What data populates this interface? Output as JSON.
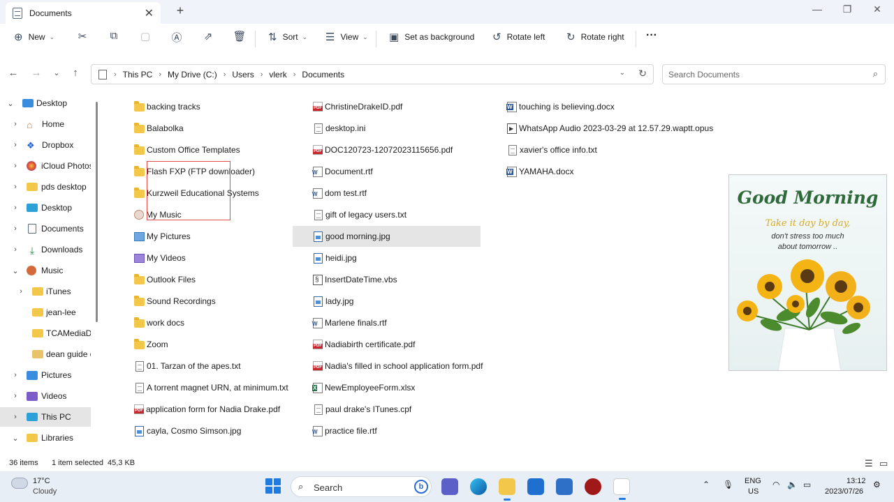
{
  "window": {
    "tab_title": "Documents"
  },
  "toolbar": {
    "new_label": "New",
    "sort_label": "Sort",
    "view_label": "View",
    "set_background_label": "Set as background",
    "rotate_left_label": "Rotate left",
    "rotate_right_label": "Rotate right",
    "more_label": "···"
  },
  "address": {
    "crumbs": [
      "This PC",
      "My Drive (C:)",
      "Users",
      "vlerk",
      "Documents"
    ],
    "search_placeholder": "Search Documents"
  },
  "sidebar": {
    "items": [
      {
        "label": "Desktop",
        "icon": "desktop-icon",
        "chevron": "down"
      },
      {
        "label": "Home",
        "icon": "home-icon",
        "chevron": "right"
      },
      {
        "label": "Dropbox",
        "icon": "dropbox-icon",
        "chevron": "right"
      },
      {
        "label": "iCloud Photos",
        "icon": "icloud-photos-icon",
        "chevron": "right"
      },
      {
        "label": "pds desktop",
        "icon": "folder-icon",
        "chevron": "right"
      },
      {
        "label": "Desktop",
        "icon": "desktop-icon",
        "chevron": "right"
      },
      {
        "label": "Documents",
        "icon": "documents-icon",
        "chevron": "right"
      },
      {
        "label": "Downloads",
        "icon": "downloads-icon",
        "chevron": "right"
      },
      {
        "label": "Music",
        "icon": "music-icon",
        "chevron": "down"
      },
      {
        "label": "iTunes",
        "icon": "folder-icon",
        "chevron": "right"
      },
      {
        "label": "jean-lee",
        "icon": "folder-icon",
        "chevron": ""
      },
      {
        "label": "TCAMediaDo",
        "icon": "folder-icon",
        "chevron": ""
      },
      {
        "label": "dean guide d",
        "icon": "folder-icon",
        "chevron": ""
      },
      {
        "label": "Pictures",
        "icon": "pictures-icon",
        "chevron": "right"
      },
      {
        "label": "Videos",
        "icon": "videos-icon",
        "chevron": "right"
      },
      {
        "label": "This PC",
        "icon": "this-pc-icon",
        "chevron": "right"
      },
      {
        "label": "Libraries",
        "icon": "libraries-icon",
        "chevron": "down"
      }
    ]
  },
  "files": {
    "column1": [
      {
        "name": "backing tracks",
        "type": "folder"
      },
      {
        "name": "Balabolka",
        "type": "folder"
      },
      {
        "name": "Custom Office Templates",
        "type": "folder"
      },
      {
        "name": "Flash FXP (FTP downloader)",
        "type": "folder"
      },
      {
        "name": "Kurzweil Educational Systems",
        "type": "folder"
      },
      {
        "name": "My Music",
        "type": "music"
      },
      {
        "name": "My Pictures",
        "type": "pics"
      },
      {
        "name": "My Videos",
        "type": "vids"
      },
      {
        "name": "Outlook Files",
        "type": "folder"
      },
      {
        "name": "Sound Recordings",
        "type": "folder"
      },
      {
        "name": "work docs",
        "type": "folder"
      },
      {
        "name": "Zoom",
        "type": "folder"
      },
      {
        "name": "01. Tarzan of the apes.txt",
        "type": "doc"
      },
      {
        "name": "A torrent magnet URN, at minimum.txt",
        "type": "doc"
      },
      {
        "name": "application form for Nadia Drake.pdf",
        "type": "pdf"
      },
      {
        "name": "cayla, Cosmo Simson.jpg",
        "type": "img"
      }
    ],
    "column2": [
      {
        "name": "ChristineDrakeID.pdf",
        "type": "pdf"
      },
      {
        "name": "desktop.ini",
        "type": "doc"
      },
      {
        "name": "DOC120723-12072023115656.pdf",
        "type": "pdf"
      },
      {
        "name": "Document.rtf",
        "type": "rtf"
      },
      {
        "name": "dom test.rtf",
        "type": "rtf"
      },
      {
        "name": "gift of legacy users.txt",
        "type": "doc"
      },
      {
        "name": "good morning.jpg",
        "type": "img"
      },
      {
        "name": "heidi.jpg",
        "type": "img"
      },
      {
        "name": "InsertDateTime.vbs",
        "type": "script"
      },
      {
        "name": "lady.jpg",
        "type": "img"
      },
      {
        "name": "Marlene finals.rtf",
        "type": "rtf"
      },
      {
        "name": "Nadiabirth certificate.pdf",
        "type": "pdf"
      },
      {
        "name": "Nadia's filled in school application form.pdf",
        "type": "pdf"
      },
      {
        "name": "NewEmployeeForm.xlsx",
        "type": "excel"
      },
      {
        "name": "paul drake's ITunes.cpf",
        "type": "doc"
      },
      {
        "name": "practice file.rtf",
        "type": "rtf"
      }
    ],
    "column3": [
      {
        "name": "touching is believing.docx",
        "type": "word"
      },
      {
        "name": "WhatsApp Audio 2023-03-29 at 12.57.29.waptt.opus",
        "type": "audio"
      },
      {
        "name": "xavier's office info.txt",
        "type": "doc"
      },
      {
        "name": "YAMAHA.docx",
        "type": "word"
      }
    ],
    "selected": "good morning.jpg"
  },
  "preview": {
    "title": "Good Morning",
    "line1": "Take it day by day,",
    "line2": "don't stress too much",
    "line3": "about tomorrow .."
  },
  "status": {
    "count": "36 items",
    "selection": "1 item selected",
    "size": "45,3 KB"
  },
  "taskbar": {
    "temp": "17°C",
    "condition": "Cloudy",
    "search_label": "Search",
    "lang1": "ENG",
    "lang2": "US",
    "time": "13:12",
    "date": "2023/07/26"
  }
}
